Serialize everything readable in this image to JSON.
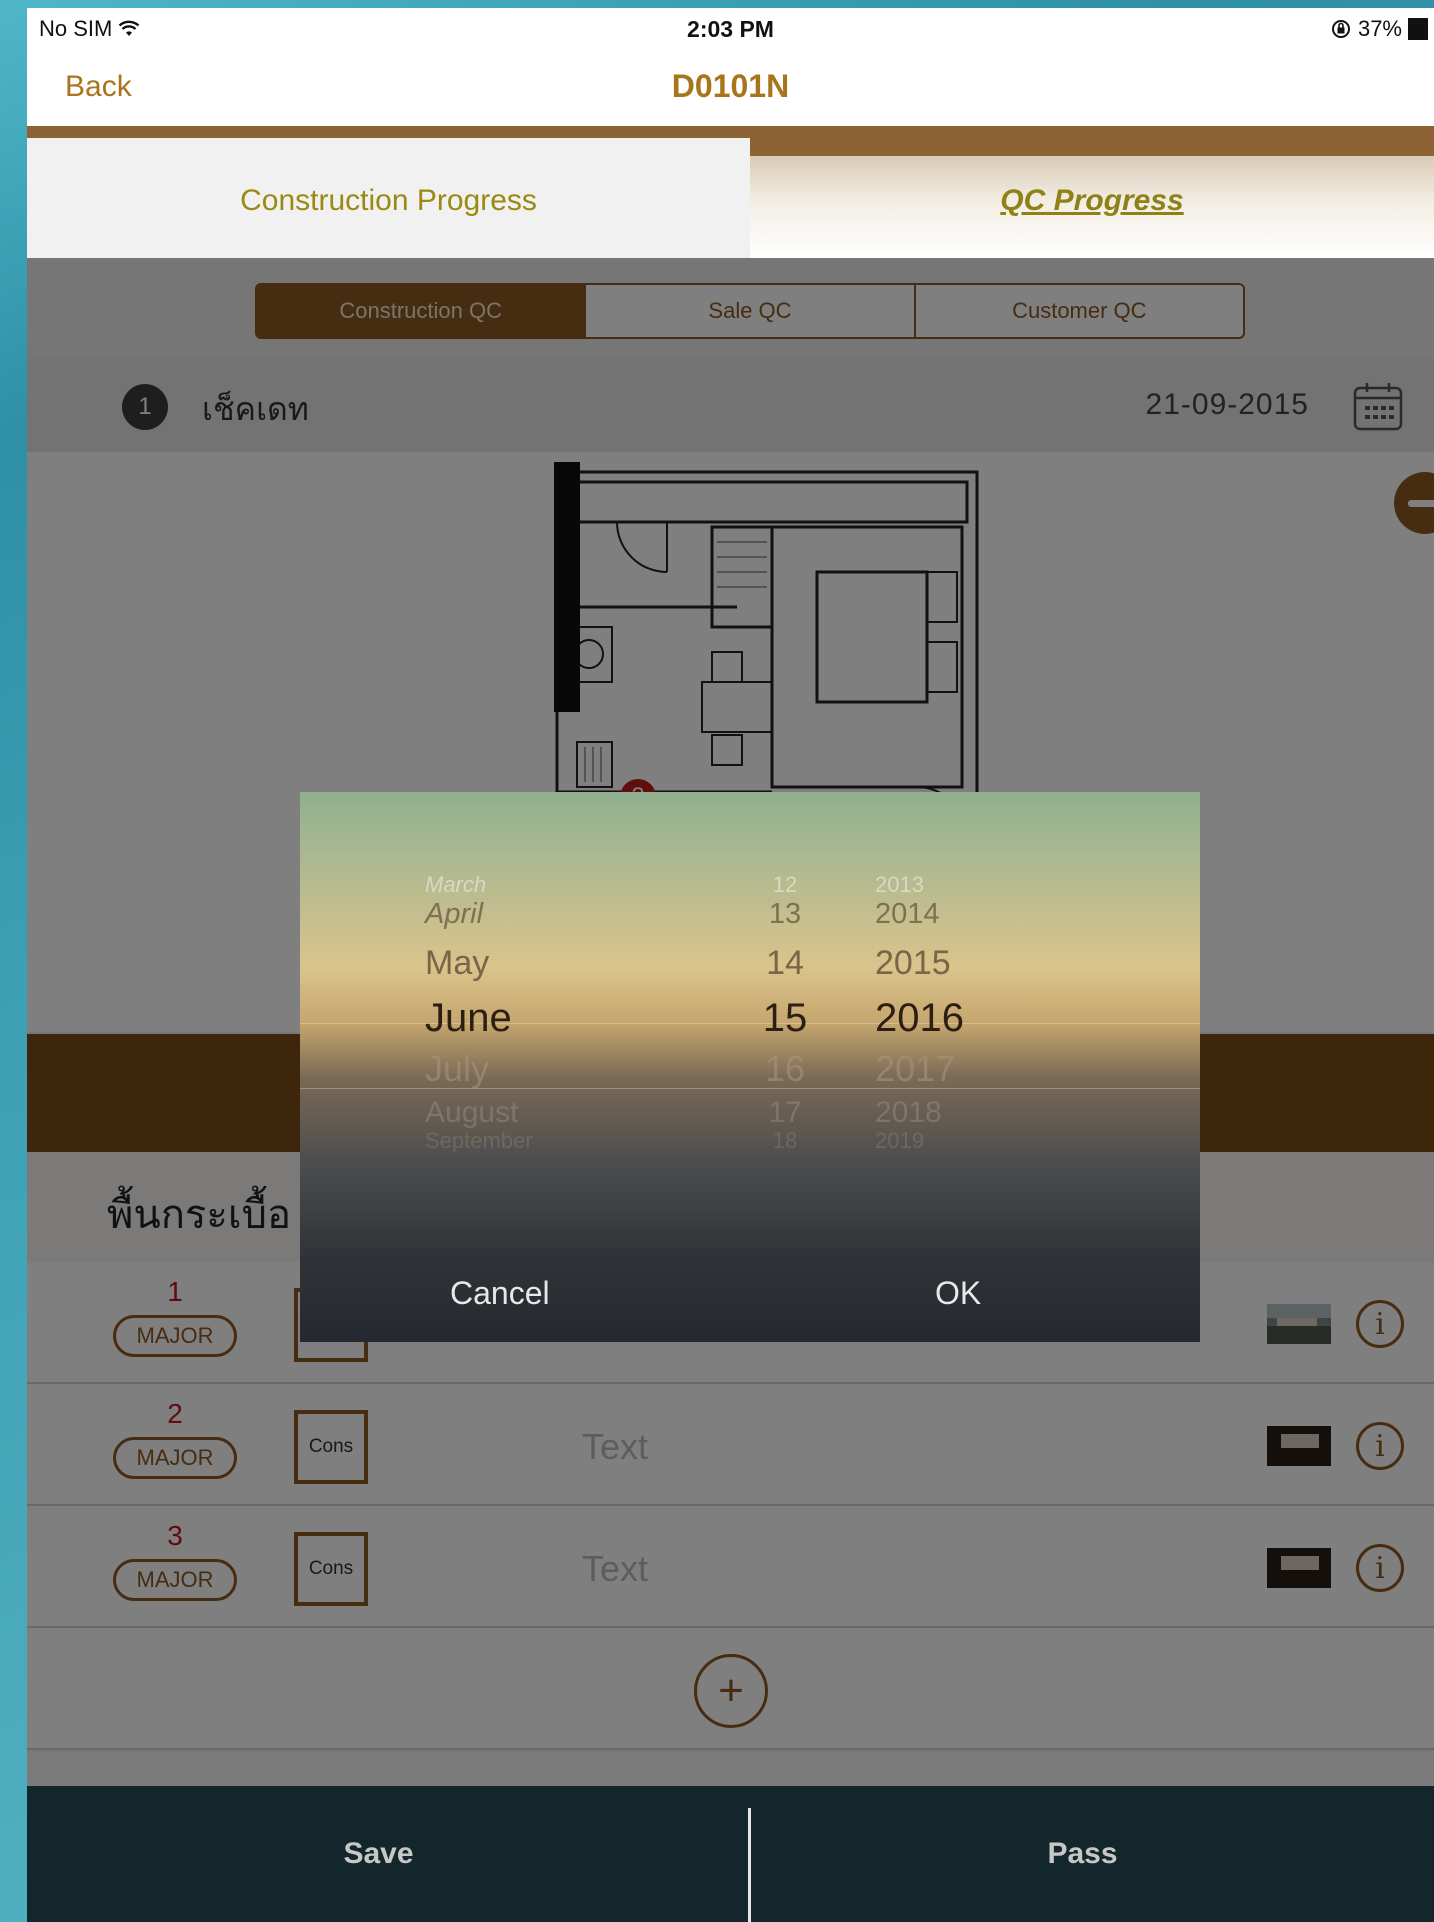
{
  "status_bar": {
    "carrier": "No SIM",
    "time": "2:03 PM",
    "battery": "37%",
    "wifi_icon": "wifi-icon",
    "lock_icon": "rotation-lock-icon"
  },
  "nav": {
    "back_label": "Back",
    "title": "D0101N"
  },
  "top_tabs": [
    {
      "label": "Construction Progress",
      "selected": false
    },
    {
      "label": "QC Progress",
      "selected": true
    }
  ],
  "qc_segments": [
    {
      "label": "Construction QC",
      "selected": true
    },
    {
      "label": "Sale QC",
      "selected": false
    },
    {
      "label": "Customer QC",
      "selected": false
    }
  ],
  "check": {
    "number": "1",
    "label": "เช็คเดท",
    "date": "21-09-2015",
    "calendar_icon": "calendar-icon"
  },
  "plan": {
    "marker_number": "3",
    "zoom_out_icon": "minus-icon"
  },
  "category": {
    "label_visible": "พื้นกระเบื้อ"
  },
  "items": [
    {
      "number": "1",
      "severity": "MAJOR",
      "type": "",
      "text": ""
    },
    {
      "number": "2",
      "severity": "MAJOR",
      "type": "Cons",
      "text": "Text"
    },
    {
      "number": "3",
      "severity": "MAJOR",
      "type": "Cons",
      "text": "Text"
    }
  ],
  "add_icon": "plus-icon",
  "info_icon": "info-icon",
  "picker": {
    "months": [
      "March",
      "April",
      "May",
      "June",
      "July",
      "August",
      "September"
    ],
    "days": [
      "12",
      "13",
      "14",
      "15",
      "16",
      "17",
      "18"
    ],
    "years": [
      "2013",
      "2014",
      "2015",
      "2016",
      "2017",
      "2018",
      "2019"
    ],
    "selected_month": "June",
    "selected_day": "15",
    "selected_year": "2016",
    "cancel_label": "Cancel",
    "ok_label": "OK"
  },
  "bottom_bar": {
    "save_label": "Save",
    "pass_label": "Pass"
  },
  "colors": {
    "brand_brown": "#8d5a22",
    "gold_text": "#a8741c",
    "alert_red": "#c3151f",
    "bottom_bar": "#13262b"
  }
}
